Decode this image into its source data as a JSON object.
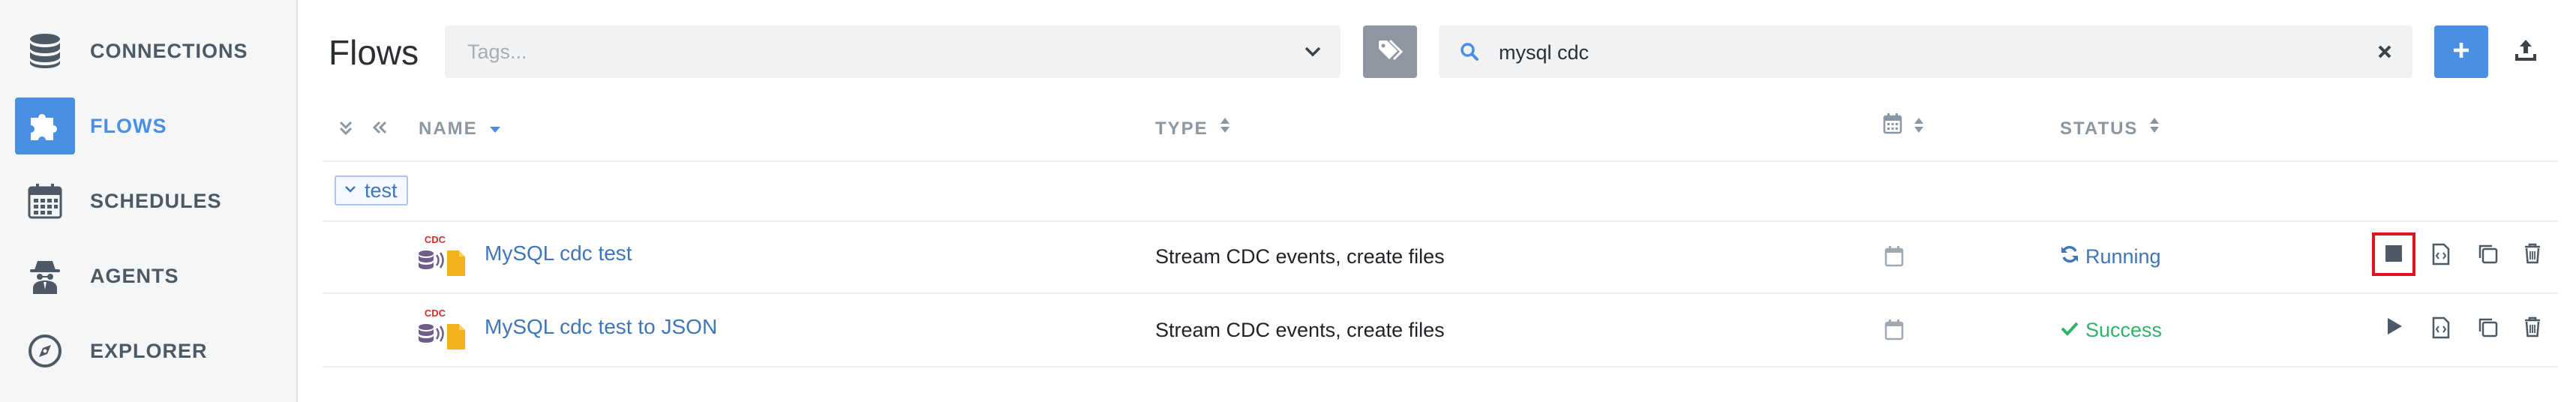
{
  "colors": {
    "accent": "#4a90e2",
    "link": "#3f76b8",
    "success": "#2fb36a",
    "running": "#3f76b8",
    "highlight": "#e0141e",
    "tag_button": "#8d96a1"
  },
  "sidebar": {
    "items": [
      {
        "label": "CONNECTIONS",
        "icon": "database-icon",
        "active": false
      },
      {
        "label": "FLOWS",
        "icon": "puzzle-icon",
        "active": true
      },
      {
        "label": "SCHEDULES",
        "icon": "calendar-icon",
        "active": false
      },
      {
        "label": "AGENTS",
        "icon": "spy-agent-icon",
        "active": false
      },
      {
        "label": "EXPLORER",
        "icon": "compass-icon",
        "active": false
      }
    ]
  },
  "header": {
    "title": "Flows",
    "tags_placeholder": "Tags...",
    "search_value": "mysql cdc"
  },
  "table": {
    "columns": {
      "name": "NAME",
      "type": "TYPE",
      "status": "STATUS"
    },
    "group": {
      "name": "test"
    },
    "rows": [
      {
        "icon_label": "CDC",
        "name": "MySQL cdc test",
        "type": "Stream CDC events, create files",
        "status": "Running",
        "status_icon": "sync-icon",
        "primary_action": "stop-icon"
      },
      {
        "icon_label": "CDC",
        "name": "MySQL cdc test to JSON",
        "type": "Stream CDC events, create files",
        "status": "Success",
        "status_icon": "check-icon",
        "primary_action": "play-icon"
      }
    ]
  }
}
